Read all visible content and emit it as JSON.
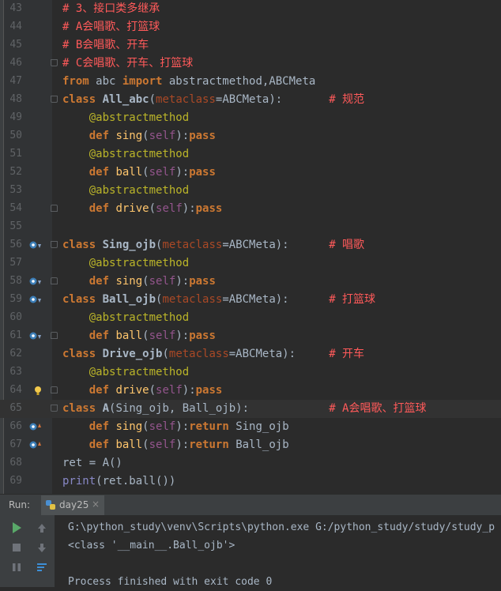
{
  "editor": {
    "lines": [
      {
        "num": "43",
        "tokens": [
          {
            "t": "# 3、接口类多继承",
            "c": "cm"
          }
        ]
      },
      {
        "num": "44",
        "tokens": [
          {
            "t": "# A会唱歌、打篮球",
            "c": "cm"
          }
        ]
      },
      {
        "num": "45",
        "tokens": [
          {
            "t": "# B会唱歌、开车",
            "c": "cm"
          }
        ]
      },
      {
        "num": "46",
        "tokens": [
          {
            "t": "# C会唱歌、开车、打篮球",
            "c": "cm"
          }
        ]
      },
      {
        "num": "47",
        "tokens": [
          {
            "t": "from",
            "c": "k"
          },
          {
            "t": " abc ",
            "c": ""
          },
          {
            "t": "import",
            "c": "k"
          },
          {
            "t": " abstractmethod,ABCMeta",
            "c": ""
          }
        ]
      },
      {
        "num": "48",
        "tokens": [
          {
            "t": "class",
            "c": "k"
          },
          {
            "t": " ",
            "c": ""
          },
          {
            "t": "All_abc",
            "c": "cls"
          },
          {
            "t": "(",
            "c": ""
          },
          {
            "t": "metaclass",
            "c": "param"
          },
          {
            "t": "=ABCMeta):",
            "c": ""
          },
          {
            "t": "       # 规范",
            "c": "cm"
          }
        ]
      },
      {
        "num": "49",
        "tokens": [
          {
            "t": "    ",
            "c": ""
          },
          {
            "t": "@abstractmethod",
            "c": "deco"
          }
        ]
      },
      {
        "num": "50",
        "tokens": [
          {
            "t": "    ",
            "c": ""
          },
          {
            "t": "def",
            "c": "k"
          },
          {
            "t": " ",
            "c": ""
          },
          {
            "t": "sing",
            "c": "f"
          },
          {
            "t": "(",
            "c": ""
          },
          {
            "t": "self",
            "c": "self"
          },
          {
            "t": "):",
            "c": ""
          },
          {
            "t": "pass",
            "c": "k"
          }
        ]
      },
      {
        "num": "51",
        "tokens": [
          {
            "t": "    ",
            "c": ""
          },
          {
            "t": "@abstractmethod",
            "c": "deco"
          }
        ]
      },
      {
        "num": "52",
        "tokens": [
          {
            "t": "    ",
            "c": ""
          },
          {
            "t": "def",
            "c": "k"
          },
          {
            "t": " ",
            "c": ""
          },
          {
            "t": "ball",
            "c": "f"
          },
          {
            "t": "(",
            "c": ""
          },
          {
            "t": "self",
            "c": "self"
          },
          {
            "t": "):",
            "c": ""
          },
          {
            "t": "pass",
            "c": "k"
          }
        ]
      },
      {
        "num": "53",
        "tokens": [
          {
            "t": "    ",
            "c": ""
          },
          {
            "t": "@abstractmethod",
            "c": "deco"
          }
        ]
      },
      {
        "num": "54",
        "tokens": [
          {
            "t": "    ",
            "c": ""
          },
          {
            "t": "def",
            "c": "k"
          },
          {
            "t": " ",
            "c": ""
          },
          {
            "t": "drive",
            "c": "f"
          },
          {
            "t": "(",
            "c": ""
          },
          {
            "t": "self",
            "c": "self"
          },
          {
            "t": "):",
            "c": ""
          },
          {
            "t": "pass",
            "c": "k"
          }
        ]
      },
      {
        "num": "55",
        "tokens": []
      },
      {
        "num": "56",
        "tokens": [
          {
            "t": "class",
            "c": "k"
          },
          {
            "t": " ",
            "c": ""
          },
          {
            "t": "Sing_ojb",
            "c": "cls"
          },
          {
            "t": "(",
            "c": ""
          },
          {
            "t": "metaclass",
            "c": "param"
          },
          {
            "t": "=ABCMeta):",
            "c": ""
          },
          {
            "t": "      # 唱歌",
            "c": "cm"
          }
        ]
      },
      {
        "num": "57",
        "tokens": [
          {
            "t": "    ",
            "c": ""
          },
          {
            "t": "@abstractmethod",
            "c": "deco"
          }
        ]
      },
      {
        "num": "58",
        "tokens": [
          {
            "t": "    ",
            "c": ""
          },
          {
            "t": "def",
            "c": "k"
          },
          {
            "t": " ",
            "c": ""
          },
          {
            "t": "sing",
            "c": "f"
          },
          {
            "t": "(",
            "c": ""
          },
          {
            "t": "self",
            "c": "self"
          },
          {
            "t": "):",
            "c": ""
          },
          {
            "t": "pass",
            "c": "k"
          }
        ]
      },
      {
        "num": "59",
        "tokens": [
          {
            "t": "class",
            "c": "k"
          },
          {
            "t": " ",
            "c": ""
          },
          {
            "t": "Ball_ojb",
            "c": "cls"
          },
          {
            "t": "(",
            "c": ""
          },
          {
            "t": "metaclass",
            "c": "param"
          },
          {
            "t": "=ABCMeta):",
            "c": ""
          },
          {
            "t": "      # 打篮球",
            "c": "cm"
          }
        ]
      },
      {
        "num": "60",
        "tokens": [
          {
            "t": "    ",
            "c": ""
          },
          {
            "t": "@abstractmethod",
            "c": "deco"
          }
        ]
      },
      {
        "num": "61",
        "tokens": [
          {
            "t": "    ",
            "c": ""
          },
          {
            "t": "def",
            "c": "k"
          },
          {
            "t": " ",
            "c": ""
          },
          {
            "t": "ball",
            "c": "f"
          },
          {
            "t": "(",
            "c": ""
          },
          {
            "t": "self",
            "c": "self"
          },
          {
            "t": "):",
            "c": ""
          },
          {
            "t": "pass",
            "c": "k"
          }
        ]
      },
      {
        "num": "62",
        "tokens": [
          {
            "t": "class",
            "c": "k"
          },
          {
            "t": " ",
            "c": ""
          },
          {
            "t": "Drive_ojb",
            "c": "cls"
          },
          {
            "t": "(",
            "c": ""
          },
          {
            "t": "metaclass",
            "c": "param"
          },
          {
            "t": "=ABCMeta):",
            "c": ""
          },
          {
            "t": "     # 开车",
            "c": "cm"
          }
        ]
      },
      {
        "num": "63",
        "tokens": [
          {
            "t": "    ",
            "c": ""
          },
          {
            "t": "@abstractmethod",
            "c": "deco"
          }
        ]
      },
      {
        "num": "64",
        "tokens": [
          {
            "t": "    ",
            "c": ""
          },
          {
            "t": "def",
            "c": "k"
          },
          {
            "t": " ",
            "c": ""
          },
          {
            "t": "drive",
            "c": "f"
          },
          {
            "t": "(",
            "c": ""
          },
          {
            "t": "self",
            "c": "self"
          },
          {
            "t": "):",
            "c": ""
          },
          {
            "t": "pass",
            "c": "k"
          }
        ]
      },
      {
        "num": "65",
        "tokens": [
          {
            "t": "class",
            "c": "k"
          },
          {
            "t": " ",
            "c": ""
          },
          {
            "t": "A",
            "c": "cls"
          },
          {
            "t": "(Sing_ojb, Ball_ojb):",
            "c": ""
          },
          {
            "t": "            # A会唱歌、打篮球",
            "c": "cm"
          }
        ]
      },
      {
        "num": "66",
        "tokens": [
          {
            "t": "    ",
            "c": ""
          },
          {
            "t": "def",
            "c": "k"
          },
          {
            "t": " ",
            "c": ""
          },
          {
            "t": "sing",
            "c": "f"
          },
          {
            "t": "(",
            "c": ""
          },
          {
            "t": "self",
            "c": "self"
          },
          {
            "t": "):",
            "c": ""
          },
          {
            "t": "return",
            "c": "k"
          },
          {
            "t": " Sing_ojb",
            "c": ""
          }
        ]
      },
      {
        "num": "67",
        "tokens": [
          {
            "t": "    ",
            "c": ""
          },
          {
            "t": "def",
            "c": "k"
          },
          {
            "t": " ",
            "c": ""
          },
          {
            "t": "ball",
            "c": "f"
          },
          {
            "t": "(",
            "c": ""
          },
          {
            "t": "self",
            "c": "self"
          },
          {
            "t": "):",
            "c": ""
          },
          {
            "t": "return",
            "c": "k"
          },
          {
            "t": " Ball_ojb",
            "c": ""
          }
        ]
      },
      {
        "num": "68",
        "tokens": [
          {
            "t": "ret = A()",
            "c": ""
          }
        ]
      },
      {
        "num": "69",
        "tokens": [
          {
            "t": "print",
            "c": "df"
          },
          {
            "t": "(ret.ball())",
            "c": ""
          }
        ]
      }
    ],
    "current_line": "65"
  },
  "run_panel": {
    "label": "Run:",
    "tab_label": "day25",
    "tab_close": "×",
    "console_lines": [
      "G:\\python_study\\venv\\Scripts\\python.exe G:/python_study/study/study_p",
      "<class '__main__.Ball_ojb'>",
      "",
      "Process finished with exit code 0"
    ]
  },
  "icons": {
    "implemented_marker": "implemented-method-icon",
    "overrides_marker": "overrides-method-icon",
    "intention_bulb": "lightbulb-icon"
  },
  "colors": {
    "keyword": "#cc7832",
    "comment": "#ff5a5a",
    "decorator": "#bbb529",
    "self": "#94558d",
    "function": "#ffc66d",
    "run_green": "#4caf50"
  }
}
